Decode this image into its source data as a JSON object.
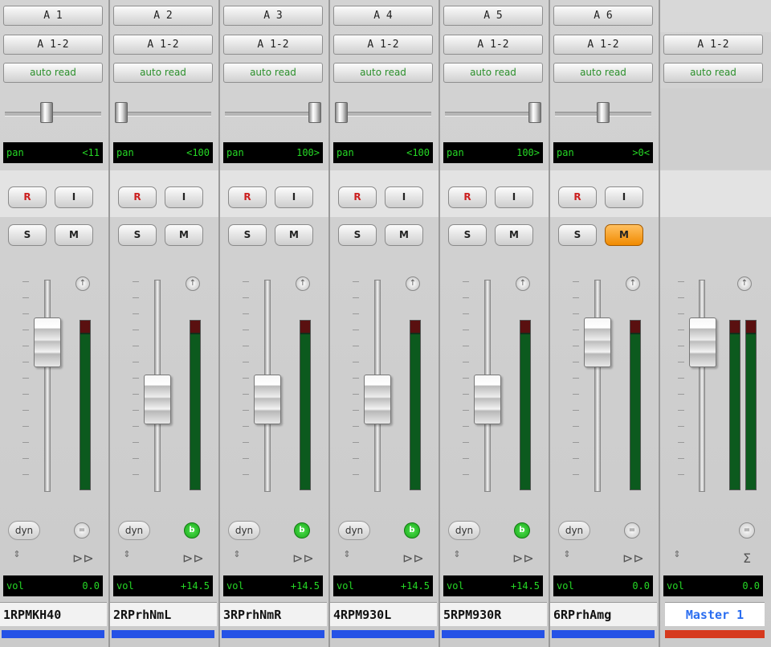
{
  "colors": {
    "lcd_text": "#25d925",
    "track_blue": "#2552e6",
    "master_red": "#d63a1e",
    "mute_active": "#f59a1a",
    "record": "#cc2020",
    "master_name_text": "#2a6df0"
  },
  "channels": [
    {
      "output": "A 1",
      "bus": "A 1-2",
      "automation": "auto read",
      "pan_label": "pan",
      "pan_value": "<11",
      "record_label": "R",
      "input_label": "I",
      "solo_label": "S",
      "mute_label": "M",
      "mute_active": false,
      "dyn_label": "dyn",
      "auto_icon": "↑",
      "insert_icon": "=",
      "insert_active": false,
      "output_icon": "⊳⊳",
      "vol_label": "vol",
      "vol_value": "0.0",
      "name": "1RPMKH40",
      "track_color": "#2552e6",
      "pan_fraction": 0.42,
      "fader_fraction": 0.78
    },
    {
      "output": "A 2",
      "bus": "A 1-2",
      "automation": "auto read",
      "pan_label": "pan",
      "pan_value": "<100",
      "record_label": "R",
      "input_label": "I",
      "solo_label": "S",
      "mute_label": "M",
      "mute_active": false,
      "dyn_label": "dyn",
      "auto_icon": "↑",
      "insert_icon": "b",
      "insert_active": true,
      "output_icon": "⊳⊳",
      "vol_label": "vol",
      "vol_value": "+14.5",
      "name": "2RPrhNmL",
      "track_color": "#2552e6",
      "pan_fraction": 0.0,
      "fader_fraction": 0.42
    },
    {
      "output": "A 3",
      "bus": "A 1-2",
      "automation": "auto read",
      "pan_label": "pan",
      "pan_value": "100>",
      "record_label": "R",
      "input_label": "I",
      "solo_label": "S",
      "mute_label": "M",
      "mute_active": false,
      "dyn_label": "dyn",
      "auto_icon": "↑",
      "insert_icon": "b",
      "insert_active": true,
      "output_icon": "⊳⊳",
      "vol_label": "vol",
      "vol_value": "+14.5",
      "name": "3RPrhNmR",
      "track_color": "#2552e6",
      "pan_fraction": 1.0,
      "fader_fraction": 0.42
    },
    {
      "output": "A 4",
      "bus": "A 1-2",
      "automation": "auto read",
      "pan_label": "pan",
      "pan_value": "<100",
      "record_label": "R",
      "input_label": "I",
      "solo_label": "S",
      "mute_label": "M",
      "mute_active": false,
      "dyn_label": "dyn",
      "auto_icon": "↑",
      "insert_icon": "b",
      "insert_active": true,
      "output_icon": "⊳⊳",
      "vol_label": "vol",
      "vol_value": "+14.5",
      "name": "4RPM930L",
      "track_color": "#2552e6",
      "pan_fraction": 0.0,
      "fader_fraction": 0.42
    },
    {
      "output": "A 5",
      "bus": "A 1-2",
      "automation": "auto read",
      "pan_label": "pan",
      "pan_value": "100>",
      "record_label": "R",
      "input_label": "I",
      "solo_label": "S",
      "mute_label": "M",
      "mute_active": false,
      "dyn_label": "dyn",
      "auto_icon": "↑",
      "insert_icon": "b",
      "insert_active": true,
      "output_icon": "⊳⊳",
      "vol_label": "vol",
      "vol_value": "+14.5",
      "name": "5RPM930R",
      "track_color": "#2552e6",
      "pan_fraction": 1.0,
      "fader_fraction": 0.42
    },
    {
      "output": "A 6",
      "bus": "A 1-2",
      "automation": "auto read",
      "pan_label": "pan",
      "pan_value": ">0<",
      "record_label": "R",
      "input_label": "I",
      "solo_label": "S",
      "mute_label": "M",
      "mute_active": true,
      "dyn_label": "dyn",
      "auto_icon": "↑",
      "insert_icon": "=",
      "insert_active": false,
      "output_icon": "⊳⊳",
      "vol_label": "vol",
      "vol_value": "0.0",
      "name": "6RPrhAmg",
      "track_color": "#2552e6",
      "pan_fraction": 0.5,
      "fader_fraction": 0.78
    }
  ],
  "master": {
    "bus": "A 1-2",
    "automation": "auto read",
    "auto_icon": "↑",
    "insert_icon": "=",
    "updown_icon": "⇕",
    "sum_icon": "Σ",
    "vol_label": "vol",
    "vol_value": "0.0",
    "name": "Master 1",
    "track_color": "#d63a1e",
    "fader_fraction": 0.78
  }
}
